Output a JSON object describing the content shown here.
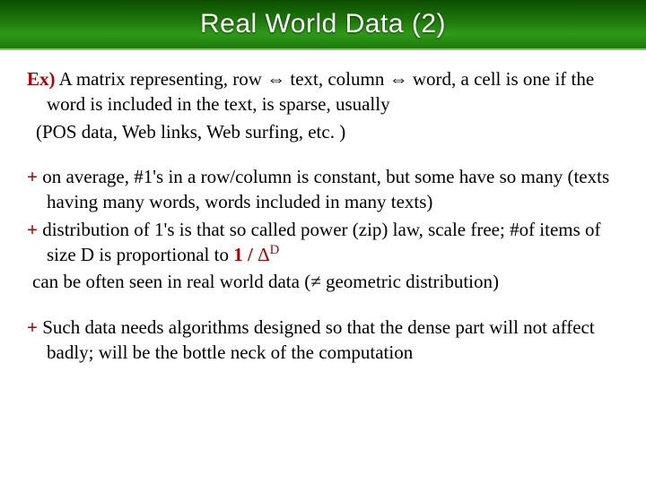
{
  "title": "Real World Data (2)",
  "ex": {
    "label": "Ex)",
    "line1": " A matrix representing, row ⇔ text, column ⇔ word, a cell is one if the word is included in the text, is sparse, usually",
    "line2": "(POS data, Web links, Web surfing, etc. )"
  },
  "p1": {
    "plus1": "+",
    "t1": " on average, #1's in a row/column is constant, but some have so many   (texts having many words, words included in many texts)",
    "plus2": "+",
    "t2": " distribution of 1's is that so called power (zip) law, scale free; #of items of size D is proportional to ",
    "ratio": "1 / ",
    "delta": "Δ",
    "dexp": "D",
    "t3": " can be often seen in real world data (≠ geometric distribution)"
  },
  "p2": {
    "plus": "+",
    "t": " Such data needs algorithms designed so that the dense part will not affect badly; will be the bottle neck of the computation"
  }
}
